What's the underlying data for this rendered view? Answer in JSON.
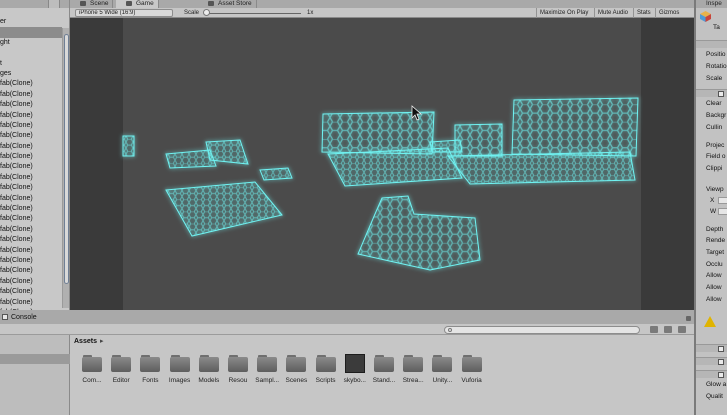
{
  "hierarchy": {
    "rows": [
      "er",
      "",
      "ght",
      "",
      "t",
      "ges",
      "fab(Clone)",
      "fab(Clone)",
      "fab(Clone)",
      "fab(Clone)",
      "fab(Clone)",
      "fab(Clone)",
      "fab(Clone)",
      "fab(Clone)",
      "fab(Clone)",
      "fab(Clone)",
      "fab(Clone)",
      "fab(Clone)",
      "fab(Clone)",
      "fab(Clone)",
      "fab(Clone)",
      "fab(Clone)",
      "fab(Clone)",
      "fab(Clone)",
      "fab(Clone)",
      "fab(Clone)",
      "fab(Clone)",
      "fab(Clone)",
      "fab(Clone)"
    ]
  },
  "tabs": [
    {
      "label": "Scene",
      "active": false
    },
    {
      "label": "Game",
      "active": true
    },
    {
      "label": "Asset Store",
      "active": false
    }
  ],
  "game_toolbar": {
    "aspect": "iPhone 5 Wide (16:9)",
    "scale_label": "Scale",
    "scale_value": "1x",
    "buttons": [
      "Maximize On Play",
      "Mute Audio",
      "Stats",
      "Gizmos"
    ]
  },
  "console": {
    "label": "Console"
  },
  "project": {
    "breadcrumb": "Assets",
    "assets": [
      {
        "label": "Com...",
        "kind": "folder"
      },
      {
        "label": "Editor",
        "kind": "folder"
      },
      {
        "label": "Fonts",
        "kind": "folder"
      },
      {
        "label": "Images",
        "kind": "folder"
      },
      {
        "label": "Models",
        "kind": "folder"
      },
      {
        "label": "Resou",
        "kind": "folder"
      },
      {
        "label": "Sampl...",
        "kind": "folder"
      },
      {
        "label": "Scenes",
        "kind": "folder"
      },
      {
        "label": "Scripts",
        "kind": "folder"
      },
      {
        "label": "skybo...",
        "kind": "skybox"
      },
      {
        "label": "Stand...",
        "kind": "folder"
      },
      {
        "label": "Strea...",
        "kind": "folder"
      },
      {
        "label": "Unity...",
        "kind": "folder"
      },
      {
        "label": "Vuforia",
        "kind": "folder"
      }
    ]
  },
  "inspector": {
    "tab_label": "Inspe",
    "title": "Ta",
    "transform_rows": [
      "Positio",
      "Rotatio",
      "Scale"
    ],
    "camera_rows": [
      "Clear",
      "Backgr",
      "Cullin",
      "Projec",
      "Field o",
      "Clippi",
      "Viewp",
      "X",
      "W",
      "Depth",
      "Rende",
      "Target",
      "Occlu",
      "Allow",
      "Allow",
      "Allow"
    ],
    "bottom_rows": [
      "Glow a",
      "Qualit"
    ]
  },
  "colors": {
    "hex_glow": "#6ff3f2",
    "hex_line": "#39c9d0",
    "game_bg": "#4b4b4b",
    "game_letterbox": "#3a3a3a",
    "warning": "#e0b400"
  }
}
